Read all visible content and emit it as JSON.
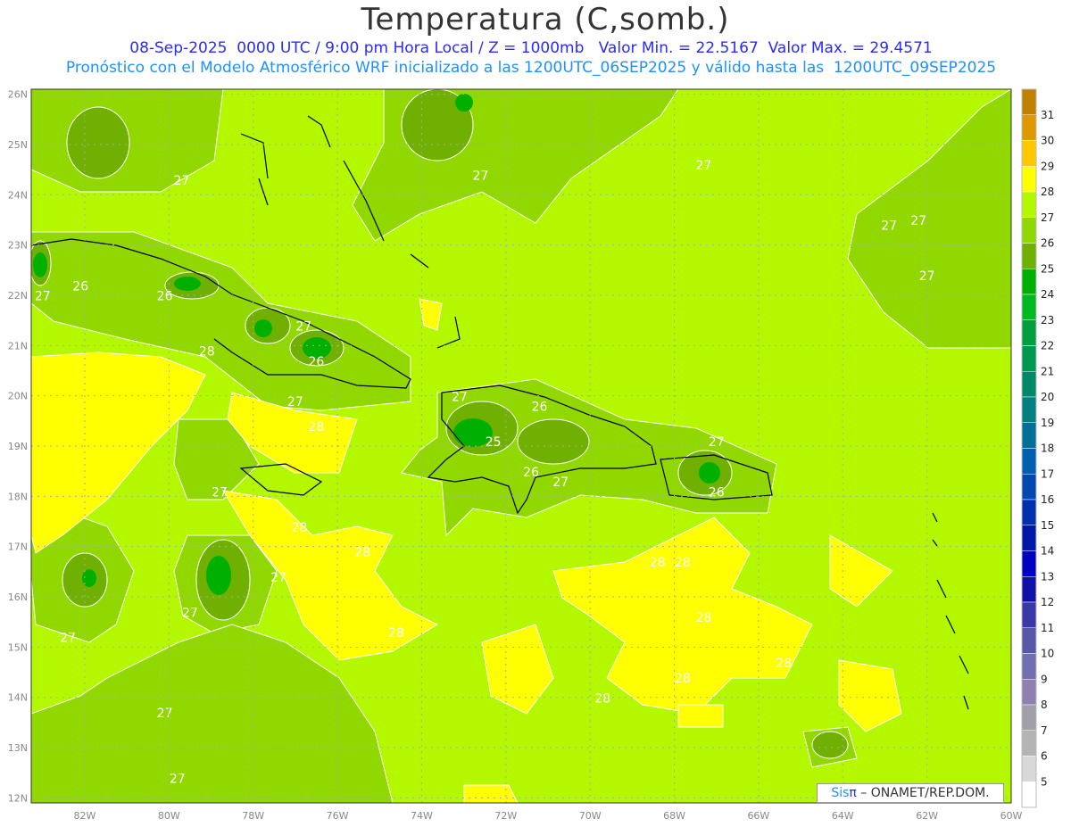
{
  "title": "Temperatura (C,somb.)",
  "subtitle_line1": "08-Sep-2025  0000 UTC / 9:00 pm Hora Local / Z = 1000mb   Valor Min. = 22.5167  Valor Max. = 29.4571",
  "subtitle_line2": "Pronóstico con el Modelo Atmosférico WRF inicializado a las 1200UTC_06SEP2025 y válido hasta las  1200UTC_09SEP2025",
  "credit": {
    "sis": "Sis",
    "pi": "π",
    "rest": " – ONAMET/REP.DOM."
  },
  "map": {
    "lon_range": [
      -83.27,
      -60
    ],
    "lat_range": [
      11.9,
      26.1
    ],
    "lat_labels": [
      "26N",
      "25N",
      "24N",
      "23N",
      "22N",
      "21N",
      "20N",
      "19N",
      "18N",
      "17N",
      "16N",
      "15N",
      "14N",
      "13N",
      "12N"
    ],
    "lon_labels": [
      "82W",
      "80W",
      "78W",
      "76W",
      "74W",
      "72W",
      "70W",
      "68W",
      "66W",
      "64W",
      "62W",
      "60W"
    ],
    "contour_labels": [
      {
        "t": "27",
        "lon": -79.7,
        "lat": 24.2
      },
      {
        "t": "27",
        "lon": -72.6,
        "lat": 24.3
      },
      {
        "t": "27",
        "lon": -67.3,
        "lat": 24.5
      },
      {
        "t": "27",
        "lon": -62.9,
        "lat": 23.3
      },
      {
        "t": "27",
        "lon": -62.2,
        "lat": 23.4
      },
      {
        "t": "27",
        "lon": -62.0,
        "lat": 22.3
      },
      {
        "t": "26",
        "lon": -82.1,
        "lat": 22.1
      },
      {
        "t": "26",
        "lon": -80.1,
        "lat": 21.9
      },
      {
        "t": "27",
        "lon": -83.0,
        "lat": 21.9
      },
      {
        "t": "27",
        "lon": -76.8,
        "lat": 21.3
      },
      {
        "t": "28",
        "lon": -79.1,
        "lat": 20.8
      },
      {
        "t": "26",
        "lon": -76.5,
        "lat": 20.6
      },
      {
        "t": "27",
        "lon": -77.0,
        "lat": 19.8
      },
      {
        "t": "27",
        "lon": -73.1,
        "lat": 19.9
      },
      {
        "t": "26",
        "lon": -71.2,
        "lat": 19.7
      },
      {
        "t": "28",
        "lon": -76.5,
        "lat": 19.3
      },
      {
        "t": "25",
        "lon": -72.3,
        "lat": 19.0
      },
      {
        "t": "26",
        "lon": -71.4,
        "lat": 18.4
      },
      {
        "t": "27",
        "lon": -70.7,
        "lat": 18.2
      },
      {
        "t": "27",
        "lon": -67.0,
        "lat": 19.0
      },
      {
        "t": "26",
        "lon": -67.0,
        "lat": 18.0
      },
      {
        "t": "27",
        "lon": -78.8,
        "lat": 18.0
      },
      {
        "t": "28",
        "lon": -76.9,
        "lat": 17.3
      },
      {
        "t": "28",
        "lon": -75.4,
        "lat": 16.8
      },
      {
        "t": "27",
        "lon": -77.4,
        "lat": 16.3
      },
      {
        "t": "27",
        "lon": -79.5,
        "lat": 15.6
      },
      {
        "t": "27",
        "lon": -82.4,
        "lat": 15.1
      },
      {
        "t": "28",
        "lon": -74.6,
        "lat": 15.2
      },
      {
        "t": "28",
        "lon": -68.4,
        "lat": 16.6
      },
      {
        "t": "28",
        "lon": -67.8,
        "lat": 16.6
      },
      {
        "t": "28",
        "lon": -67.3,
        "lat": 15.5
      },
      {
        "t": "28",
        "lon": -65.4,
        "lat": 14.6
      },
      {
        "t": "28",
        "lon": -67.8,
        "lat": 14.3
      },
      {
        "t": "28",
        "lon": -69.7,
        "lat": 13.9
      },
      {
        "t": "27",
        "lon": -80.1,
        "lat": 13.6
      },
      {
        "t": "27",
        "lon": -79.8,
        "lat": 12.3
      }
    ]
  },
  "colorbar": {
    "labels": [
      "31",
      "30",
      "29",
      "28",
      "27",
      "26",
      "25",
      "24",
      "23",
      "22",
      "21",
      "20",
      "19",
      "18",
      "17",
      "16",
      "15",
      "14",
      "13",
      "12",
      "11",
      "10",
      "9",
      "8",
      "7",
      "6",
      "5"
    ],
    "colors": [
      "#c08000",
      "#e09800",
      "#ffc800",
      "#ffff00",
      "#b4f800",
      "#90d800",
      "#70b000",
      "#00b000",
      "#00b820",
      "#00a040",
      "#009850",
      "#008868",
      "#008080",
      "#007098",
      "#0060b0",
      "#0048b0",
      "#0030b0",
      "#0018a8",
      "#0000c0",
      "#1010a8",
      "#3838a8",
      "#5858a8",
      "#7070b0",
      "#9080b0",
      "#a0a0a8",
      "#b4b4b4",
      "#d8d8d8",
      "#ffffff"
    ]
  }
}
